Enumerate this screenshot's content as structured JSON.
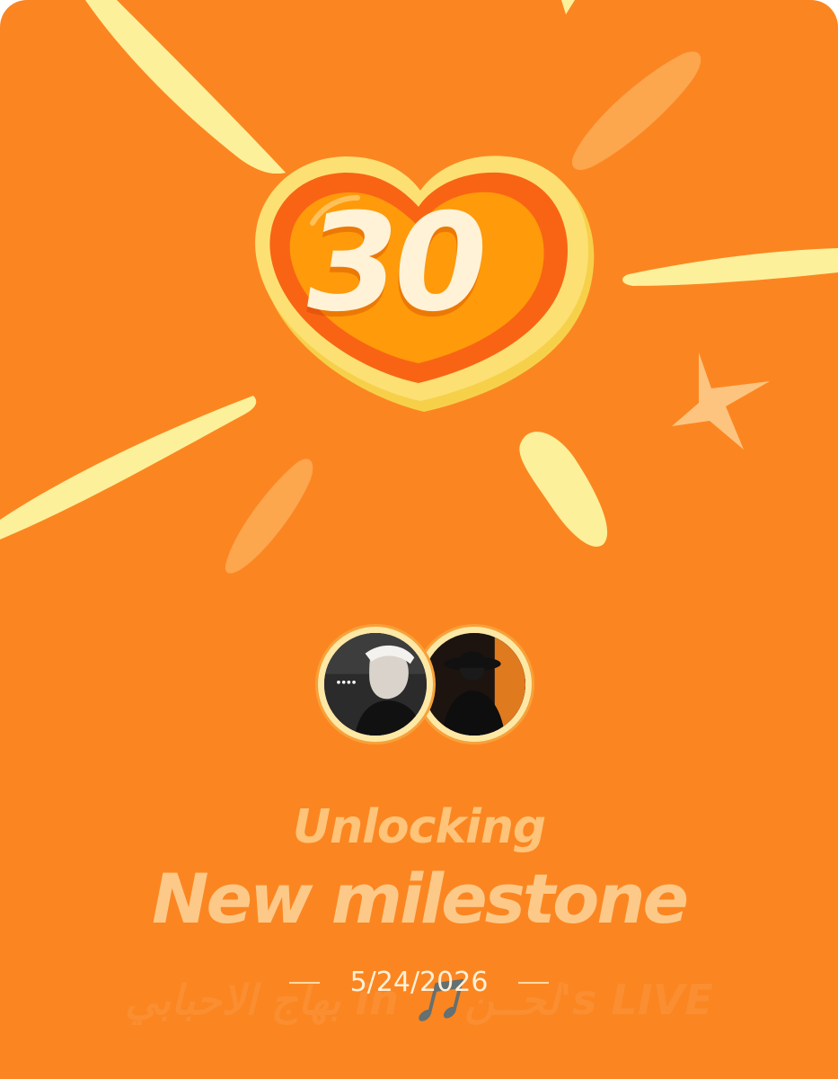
{
  "milestone": {
    "number": "30",
    "unlock_label": "Unlocking",
    "title": "New milestone",
    "date": "5/24/2026",
    "live_caption": "بهاج الاحبابي in 🎵لحــن's LIVE"
  },
  "icons": {
    "heart": "heart-icon",
    "star": "star-icon"
  },
  "colors": {
    "background": "#fb8621",
    "ray": "#fdf09a",
    "heart_outer": "#f96414",
    "heart_inner": "#ff9a0a",
    "heart_rim": "#fde074",
    "text_light": "#fdc989"
  }
}
